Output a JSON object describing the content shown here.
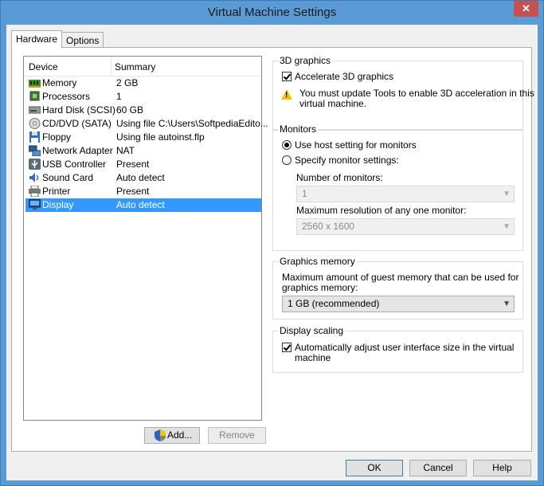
{
  "window": {
    "title": "Virtual Machine Settings",
    "close_glyph": "✕"
  },
  "tabs": [
    {
      "label": "Hardware"
    },
    {
      "label": "Options"
    }
  ],
  "device_list": {
    "col_device": "Device",
    "col_summary": "Summary",
    "rows": [
      {
        "name": "Memory",
        "summary": "2 GB",
        "icon": "memory-icon"
      },
      {
        "name": "Processors",
        "summary": "1",
        "icon": "processor-icon"
      },
      {
        "name": "Hard Disk (SCSI)",
        "summary": "60 GB",
        "icon": "hard-disk-icon"
      },
      {
        "name": "CD/DVD (SATA)",
        "summary": "Using file C:\\Users\\SoftpediaEdito...",
        "icon": "cd-dvd-icon"
      },
      {
        "name": "Floppy",
        "summary": "Using file autoinst.flp",
        "icon": "floppy-icon"
      },
      {
        "name": "Network Adapter",
        "summary": "NAT",
        "icon": "network-adapter-icon"
      },
      {
        "name": "USB Controller",
        "summary": "Present",
        "icon": "usb-icon"
      },
      {
        "name": "Sound Card",
        "summary": "Auto detect",
        "icon": "sound-card-icon"
      },
      {
        "name": "Printer",
        "summary": "Present",
        "icon": "printer-icon"
      },
      {
        "name": "Display",
        "summary": "Auto detect",
        "icon": "display-icon"
      }
    ],
    "selected": "Display"
  },
  "buttons": {
    "add": "Add...",
    "remove": "Remove",
    "ok": "OK",
    "cancel": "Cancel",
    "help": "Help"
  },
  "graphics3d": {
    "legend": "3D graphics",
    "accelerate_label": "Accelerate 3D graphics",
    "accelerate_checked": true,
    "warning_line1": "You must update Tools to enable 3D acceleration in this",
    "warning_line2": "virtual machine."
  },
  "monitors": {
    "legend": "Monitors",
    "option_host": "Use host setting for monitors",
    "option_specify": "Specify monitor settings:",
    "selected": "host",
    "number_label": "Number of monitors:",
    "number_value": "1",
    "maxres_label": "Maximum resolution of any one monitor:",
    "maxres_value": "2560 x 1600"
  },
  "graphics_memory": {
    "legend": "Graphics memory",
    "desc_line1": "Maximum amount of guest memory that can be used for",
    "desc_line2": "graphics memory:",
    "value": "1 GB (recommended)"
  },
  "display_scaling": {
    "legend": "Display scaling",
    "label_line1": "Automatically adjust user interface size in the virtual",
    "label_line2": "machine",
    "checked": true
  },
  "colors": {
    "selection": "#3399ff",
    "title_bar": "#5a9bd5",
    "close": "#c75050"
  }
}
